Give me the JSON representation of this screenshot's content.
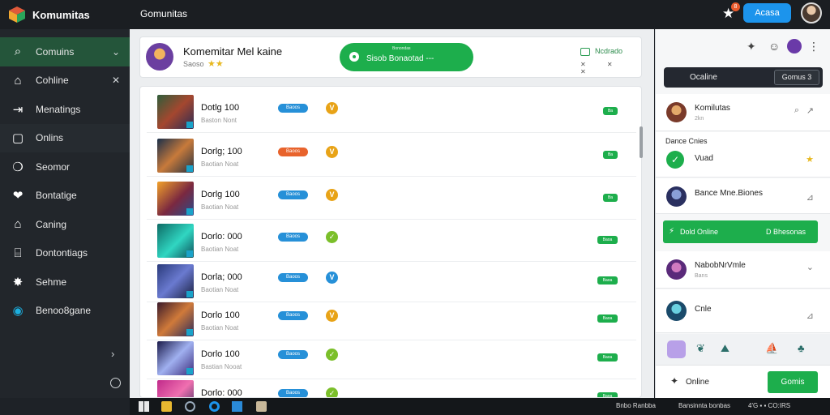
{
  "sidebar": {
    "brand": "Komumitas",
    "items": [
      {
        "label": "Comuins",
        "icon": "search-icon",
        "trail": "chevron-down-icon",
        "state": "active"
      },
      {
        "label": "Cohline",
        "icon": "home-icon",
        "trail": "close-icon",
        "state": ""
      },
      {
        "label": "Menatings",
        "icon": "login-icon",
        "trail": "",
        "state": ""
      },
      {
        "label": "Onlins",
        "icon": "square-icon",
        "trail": "",
        "state": "alt"
      },
      {
        "label": "Seomor",
        "icon": "chat-icon",
        "trail": "",
        "state": ""
      },
      {
        "label": "Bontatige",
        "icon": "bubble-icon",
        "trail": "",
        "state": ""
      },
      {
        "label": "Caning",
        "icon": "house-icon",
        "trail": "",
        "state": ""
      },
      {
        "label": "Dontontiags",
        "icon": "store-icon",
        "trail": "",
        "state": ""
      },
      {
        "label": "Sehme",
        "icon": "gear-icon",
        "trail": "",
        "state": ""
      },
      {
        "label": "Benoo8gane",
        "icon": "game-icon",
        "trail": "",
        "state": ""
      }
    ]
  },
  "topbar": {
    "title": "Gomunitas",
    "badge": "8",
    "button": "Acasa"
  },
  "profile": {
    "name": "Komemitar Mel kaine",
    "sub": "Saoso",
    "online_top": "Bonondas",
    "online_label": "Sisob Bonaotad ---",
    "notify_label": "Ncdrado",
    "notify_actions": "✕ ✕ ✕"
  },
  "list": {
    "rows": [
      {
        "title": "Dotlg 100",
        "sub": "Baston Nont",
        "tag": "Baoos",
        "tag_color": "#2690d8",
        "coin": "V",
        "coin_color": "#e8a317",
        "pill": "Ba",
        "thumb": "linear-gradient(135deg,#2f5d3a,#a4472f 50%,#2b2b55)"
      },
      {
        "title": "Dorlg; 100",
        "sub": "Baotian Noat",
        "tag": "Baoos",
        "tag_color": "#e8632c",
        "coin": "V",
        "coin_color": "#e8a317",
        "pill": "Ba",
        "thumb": "linear-gradient(135deg,#1a2f4a,#c77a3b 50%,#253040)"
      },
      {
        "title": "Dorlg 100",
        "sub": "Baotian Noat",
        "tag": "Baoos",
        "tag_color": "#2690d8",
        "coin": "V",
        "coin_color": "#e8a317",
        "pill": "Ba",
        "thumb": "linear-gradient(135deg,#f2a12a,#7a2840 55%,#2a4b8a)"
      },
      {
        "title": "Dorlo: 000",
        "sub": "Baotian Noat",
        "tag": "Baoos",
        "tag_color": "#2690d8",
        "coin": "✓",
        "coin_color": "#7bbf2a",
        "pill": "Baoa",
        "thumb": "linear-gradient(135deg,#0d6b65,#30d6c2 55%,#0d4f5a)"
      },
      {
        "title": "Dorla; 000",
        "sub": "Baotian Noat",
        "tag": "Baoos",
        "tag_color": "#2690d8",
        "coin": "V",
        "coin_color": "#2690d8",
        "pill": "Baoa",
        "thumb": "linear-gradient(135deg,#2a3a7a,#6a7ad0 50%,#1a2040)"
      },
      {
        "title": "Dorlo 100",
        "sub": "Baotian Noat",
        "tag": "Baoos",
        "tag_color": "#2690d8",
        "coin": "V",
        "coin_color": "#e8a317",
        "pill": "Baoa",
        "thumb": "linear-gradient(135deg,#3a1a2a,#d07a3a 50%,#2a2a5a)"
      },
      {
        "title": "Dorlo 100",
        "sub": "Bastian Nooat",
        "tag": "Baoos",
        "tag_color": "#2690d8",
        "coin": "✓",
        "coin_color": "#7bbf2a",
        "pill": "Baoa",
        "thumb": "linear-gradient(135deg,#1a1a4a,#a0b0f0 50%,#3a2a7a)"
      },
      {
        "title": "Dorlo: 000",
        "sub": "",
        "tag": "Baoos",
        "tag_color": "#2690d8",
        "coin": "✓",
        "coin_color": "#7bbf2a",
        "pill": "Baoa",
        "thumb": "linear-gradient(135deg,#c02a8a,#f070b0 50%,#2a2a5a)"
      }
    ]
  },
  "right": {
    "search_label": "Ocaline",
    "search_button": "Gomus 3",
    "user1_name": "Komilutas",
    "user1_sub": "2kn",
    "section_title": "Dance Cnies",
    "section_item": "Vuad",
    "user2_name": "Bance Mne.Biones",
    "green_a": "Dold Online",
    "green_b": "D Bhesonas",
    "user3_name": "NabobNrVmle",
    "user3_sub": "Bans",
    "user4_name": "Cnle",
    "footer_label": "Online",
    "footer_button": "Gomis"
  },
  "taskbar": {
    "tray1": "Bnbo Ranbba",
    "tray2": "Bansinnta bonbas",
    "tray3": "4'G ▪ ▪ CO:IRS"
  }
}
